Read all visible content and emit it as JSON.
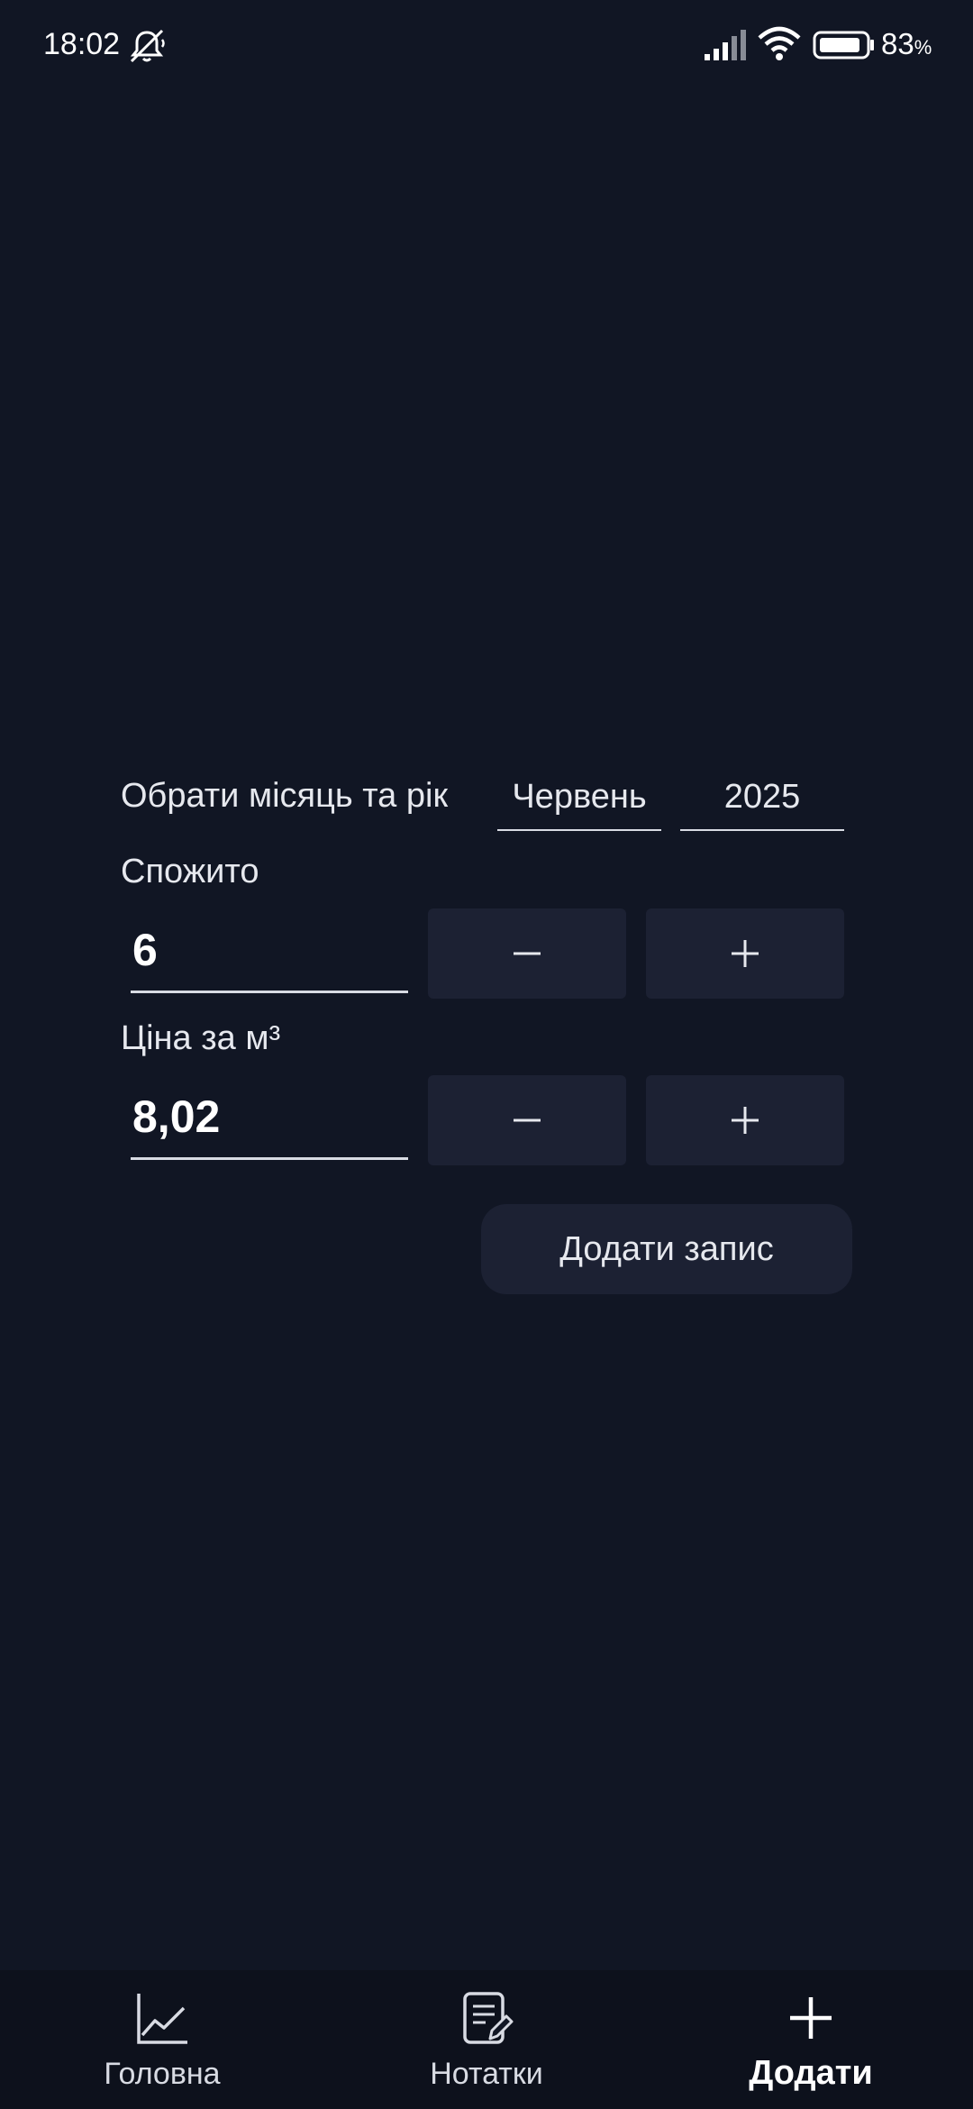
{
  "status_bar": {
    "time": "18:02",
    "battery_percent": "83",
    "battery_unit": "%",
    "icons": [
      "mute-icon",
      "signal-icon",
      "wifi-icon",
      "battery-icon"
    ]
  },
  "form": {
    "month_year_label": "Обрати місяць та рік",
    "month_value": "Червень",
    "year_value": "2025",
    "consumed_label": "Спожито",
    "consumed_value": "6",
    "price_label": "Ціна за м³",
    "price_value": "8,02",
    "decrement_symbol": "minus-icon",
    "increment_symbol": "plus-icon",
    "add_record_label": "Додати запис"
  },
  "bottom_nav": {
    "items": [
      {
        "label": "Головна",
        "icon": "chart-line-icon",
        "active": false
      },
      {
        "label": "Нотатки",
        "icon": "notes-icon",
        "active": false
      },
      {
        "label": "Додати",
        "icon": "plus-icon",
        "active": true
      }
    ]
  },
  "colors": {
    "background": "#111624",
    "button_bg": "#1c2133",
    "nav_bg": "#0d111c",
    "text": "#e6e8ee"
  }
}
